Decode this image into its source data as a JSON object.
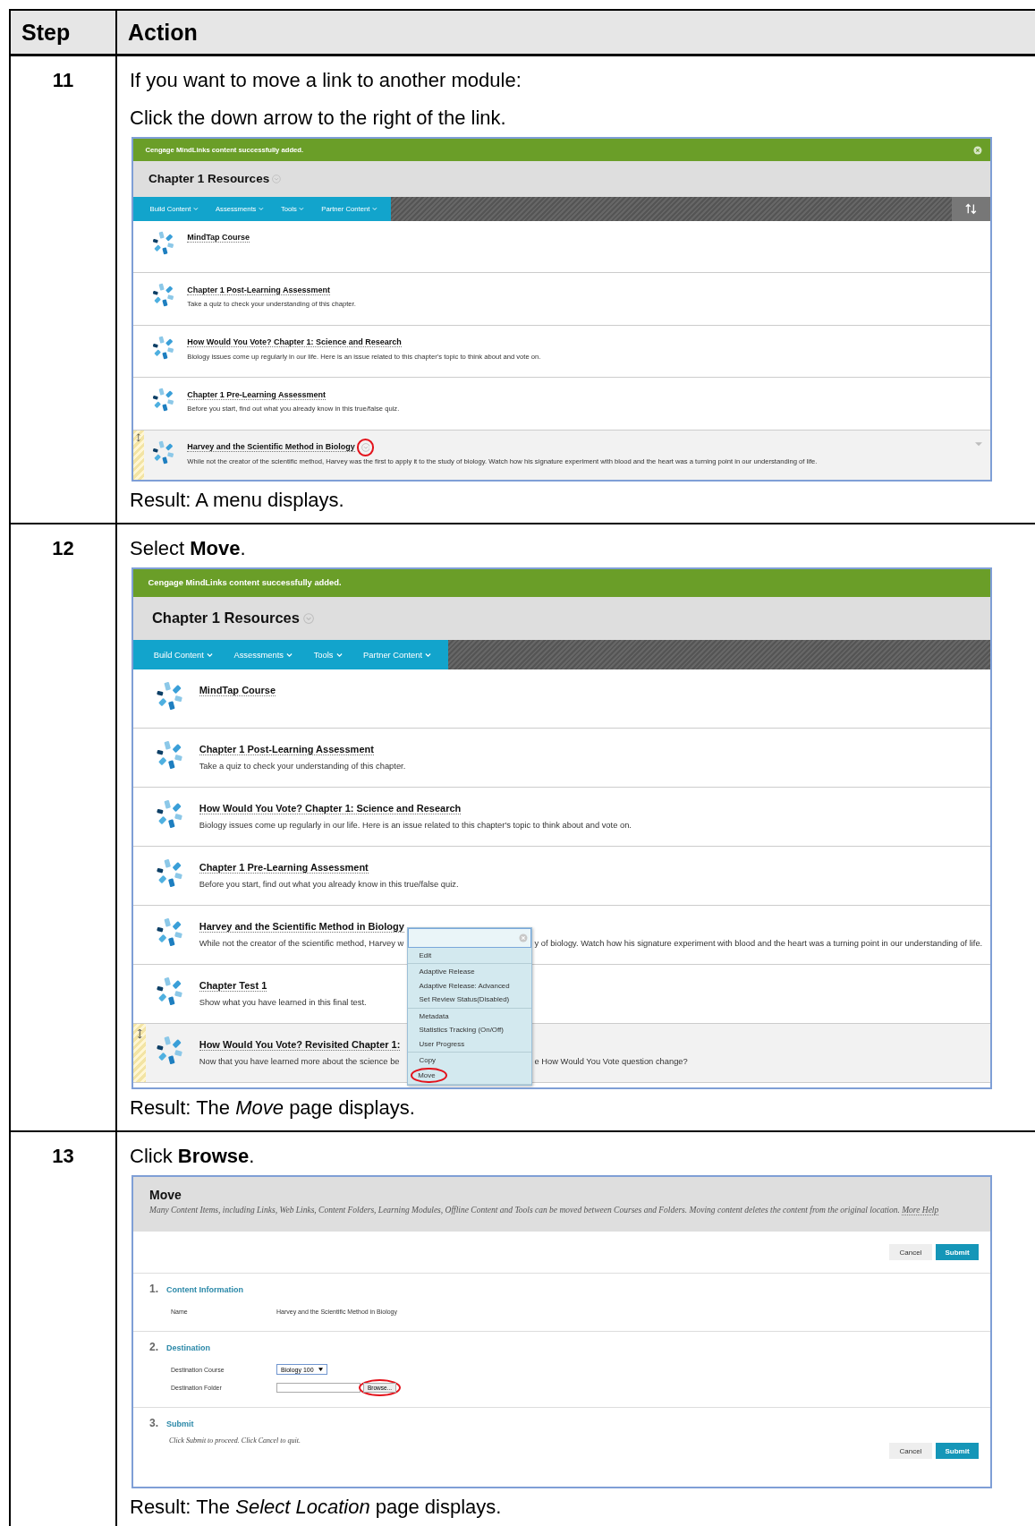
{
  "table": {
    "columns": [
      "Step",
      "Action"
    ],
    "rows": [
      {
        "step": "11",
        "lines": [
          "If you want to move a link to another module:",
          "Click the down arrow to the right of the link."
        ],
        "screenshot": {
          "kind": "course_page",
          "notice": "Cengage MindLinks content successfully added.",
          "notice_closable": true,
          "title": "Chapter 1 Resources",
          "toolbar": [
            "Build Content",
            "Assessments",
            "Tools",
            "Partner Content"
          ],
          "reorder_control": true,
          "items": [
            {
              "title": "MindTap Course",
              "highlighted": false,
              "options_circled": false,
              "row_caret": false
            },
            {
              "title": "Chapter 1 Post-Learning Assessment",
              "desc": [
                "Take a quiz to check your understanding of this chapter."
              ],
              "highlighted": false,
              "options_circled": false,
              "row_caret": false
            },
            {
              "title": "How Would You Vote? Chapter 1: Science and Research",
              "desc": [
                "Biology issues come up regularly in our life. Here is an issue related to this chapter's topic to think about and vote on."
              ],
              "highlighted": false,
              "options_circled": false,
              "row_caret": false
            },
            {
              "title": "Chapter 1 Pre-Learning Assessment",
              "desc": [
                "Before you start, find out what you already know in this true/false quiz."
              ],
              "highlighted": false,
              "options_circled": false,
              "row_caret": false
            },
            {
              "title": "Harvey and the Scientific Method in Biology",
              "desc": [
                "While not the creator of the scientific method, Harvey was the first to apply it to the study of biology. Watch how his signature experiment with blood and the heart was a turning point in our understanding of life."
              ],
              "highlighted": true,
              "options_circled": true,
              "row_caret": true
            }
          ]
        },
        "result": "Result: A menu displays."
      },
      {
        "step": "12",
        "lines": [
          "Select **Move**."
        ],
        "screenshot": {
          "kind": "course_page",
          "notice": "Cengage MindLinks content successfully added.",
          "notice_closable": false,
          "title": "Chapter 1 Resources",
          "toolbar": [
            "Build Content",
            "Assessments",
            "Tools",
            "Partner Content"
          ],
          "reorder_control": false,
          "items": [
            {
              "title": "MindTap Course",
              "highlighted": false,
              "options_circled": false,
              "row_caret": false
            },
            {
              "title": "Chapter 1 Post-Learning Assessment",
              "desc": [
                "Take a quiz to check your understanding of this chapter."
              ],
              "highlighted": false,
              "options_circled": false,
              "row_caret": false
            },
            {
              "title": "How Would You Vote? Chapter 1: Science and Research",
              "desc": [
                "Biology issues come up regularly in our life. Here is an issue related to this chapter's topic to think about and vote on."
              ],
              "highlighted": false,
              "options_circled": false,
              "row_caret": false
            },
            {
              "title": "Chapter 1 Pre-Learning Assessment",
              "desc": [
                "Before you start, find out what you already know in this true/false quiz."
              ],
              "highlighted": false,
              "options_circled": false,
              "row_caret": false
            },
            {
              "title": "Harvey and the Scientific Method in Biology",
              "desc": [
                "While not the creator of the scientific method, Harvey w",
                "y of biology. Watch how his signature experiment with blood and the heart was a turning point in our understanding of life."
              ],
              "highlighted": false,
              "options_circled": false,
              "row_caret": false
            },
            {
              "title": "Chapter Test 1",
              "desc": [
                "Show what you have learned in this final test."
              ],
              "highlighted": false,
              "options_circled": false,
              "row_caret": false
            },
            {
              "title": "How Would You Vote? Revisited Chapter 1:",
              "desc": [
                "Now that you have learned more about the science be",
                "e How Would You Vote question change?"
              ],
              "highlighted": true,
              "options_circled": false,
              "row_caret": false
            }
          ],
          "menu": {
            "groups": [
              {
                "items": [
                  {
                    "label": "Edit",
                    "circled": false
                  }
                ]
              },
              {
                "items": [
                  {
                    "label": "Adaptive Release",
                    "circled": false
                  },
                  {
                    "label": "Adaptive Release: Advanced",
                    "circled": false
                  },
                  {
                    "label": "Set Review Status(Disabled)",
                    "circled": false
                  }
                ]
              },
              {
                "items": [
                  {
                    "label": "Metadata",
                    "circled": false
                  },
                  {
                    "label": "Statistics Tracking (On/Off)",
                    "circled": false
                  },
                  {
                    "label": "User Progress",
                    "circled": false
                  }
                ]
              },
              {
                "items": [
                  {
                    "label": "Copy",
                    "circled": false
                  },
                  {
                    "label": "Move",
                    "circled": true
                  }
                ]
              }
            ]
          }
        },
        "result": "Result: The *Move* page displays."
      },
      {
        "step": "13",
        "lines": [
          "Click **Browse**."
        ],
        "screenshot": {
          "kind": "move_page",
          "title": "Move",
          "description": "Many Content Items, including Links, Web Links, Content Folders, Learning Modules, Offline Content and Tools can be moved between Courses and Folders. Moving content deletes the content from the original location.",
          "help_link": "More Help",
          "top_buttons": [
            {
              "label": "Cancel",
              "kind": "secondary"
            },
            {
              "label": "Submit",
              "kind": "primary"
            }
          ],
          "sections": [
            {
              "number": "1.",
              "title": "Content Information",
              "fields": [
                {
                  "label": "Name",
                  "kind": "text",
                  "value": "Harvey and the Scientific Method in Biology"
                }
              ]
            },
            {
              "number": "2.",
              "title": "Destination",
              "fields": [
                {
                  "label": "Destination Course",
                  "kind": "select",
                  "value": "Biology 100"
                },
                {
                  "label": "Destination Folder",
                  "kind": "browse",
                  "button": "Browse...",
                  "circled": true
                }
              ]
            },
            {
              "number": "3.",
              "title": "Submit",
              "note": "Click Submit to proceed. Click Cancel to quit."
            }
          ],
          "bottom_buttons": [
            {
              "label": "Cancel",
              "kind": "secondary"
            },
            {
              "label": "Submit",
              "kind": "primary"
            }
          ]
        },
        "result": "Result: The *Select Location* page displays."
      }
    ]
  }
}
